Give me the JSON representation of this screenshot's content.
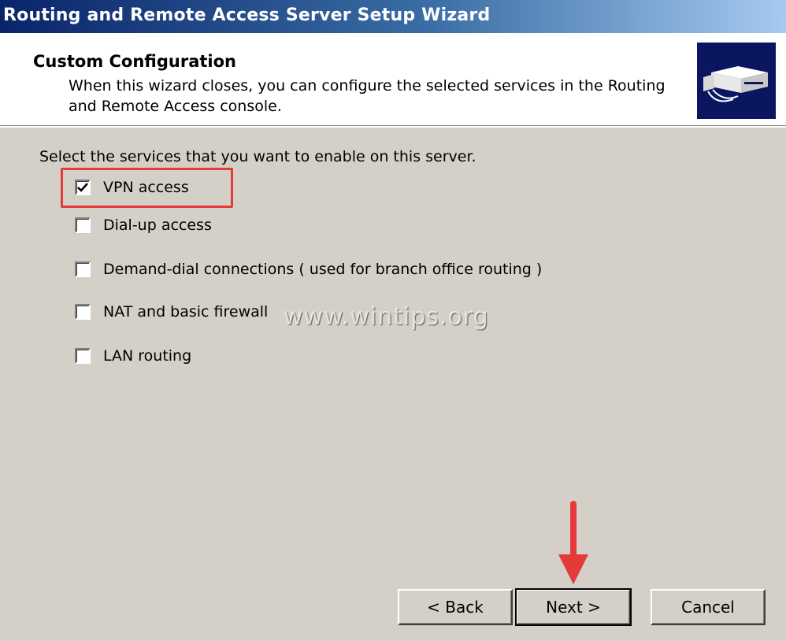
{
  "window": {
    "title": "Routing and Remote Access Server Setup Wizard"
  },
  "header": {
    "title": "Custom Configuration",
    "subtitle": "When this wizard closes, you can configure the selected services in the Routing and Remote Access console."
  },
  "body": {
    "instruction": "Select the services that you want to enable on this server.",
    "options": [
      {
        "label": "VPN access",
        "checked": true
      },
      {
        "label": "Dial-up access",
        "checked": false
      },
      {
        "label": "Demand-dial connections ( used for branch office routing )",
        "checked": false
      },
      {
        "label": "NAT and basic firewall",
        "checked": false
      },
      {
        "label": "LAN routing",
        "checked": false
      }
    ],
    "watermark": "www.wintips.org",
    "highlight_color": "#e53a3a"
  },
  "buttons": {
    "back_label": "< Back",
    "next_label": "Next >",
    "cancel_label": "Cancel"
  },
  "colors": {
    "title_bar": "#0a246a",
    "dialog_face": "#d4d0c8",
    "header_bg": "#ffffff",
    "annotation_red": "#e53a3a"
  }
}
